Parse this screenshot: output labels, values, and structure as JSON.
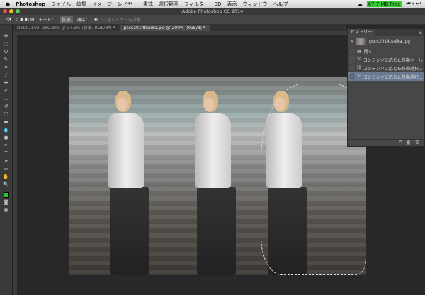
{
  "menubar": {
    "apple": "",
    "app": "Photoshop",
    "items": [
      "ファイル",
      "編集",
      "イメージ",
      "レイヤー",
      "書式",
      "選択範囲",
      "フィルター",
      "3D",
      "表示",
      "ウィンドウ",
      "ヘルプ"
    ],
    "memory": "67.7 MB Free"
  },
  "window": {
    "title": "Adobe Photoshop CC 2014"
  },
  "options": {
    "mode_label": "モード：",
    "mode_value": "拡張",
    "adapt_label": "適応：",
    "all_layers": "全レイヤーを対象"
  },
  "tabs": [
    {
      "label": "DSC01503_DxO.dng @ 37.5% (背景, RGB/8*) *"
    },
    {
      "label": "pscc2014tsuika.jpg @ 200% (RGB/8) *"
    }
  ],
  "history": {
    "title": "ヒストリー",
    "snapshot": "pscc2014tsuika.jpg",
    "items": [
      "開く",
      "コンテンツに応じた移動ツール",
      "コンテンツに応じた移動選択...",
      "コンテンツに応じた移動選択..."
    ]
  },
  "colors": {
    "foreground": "#22cc22",
    "selected_row": "#6b7a93"
  }
}
